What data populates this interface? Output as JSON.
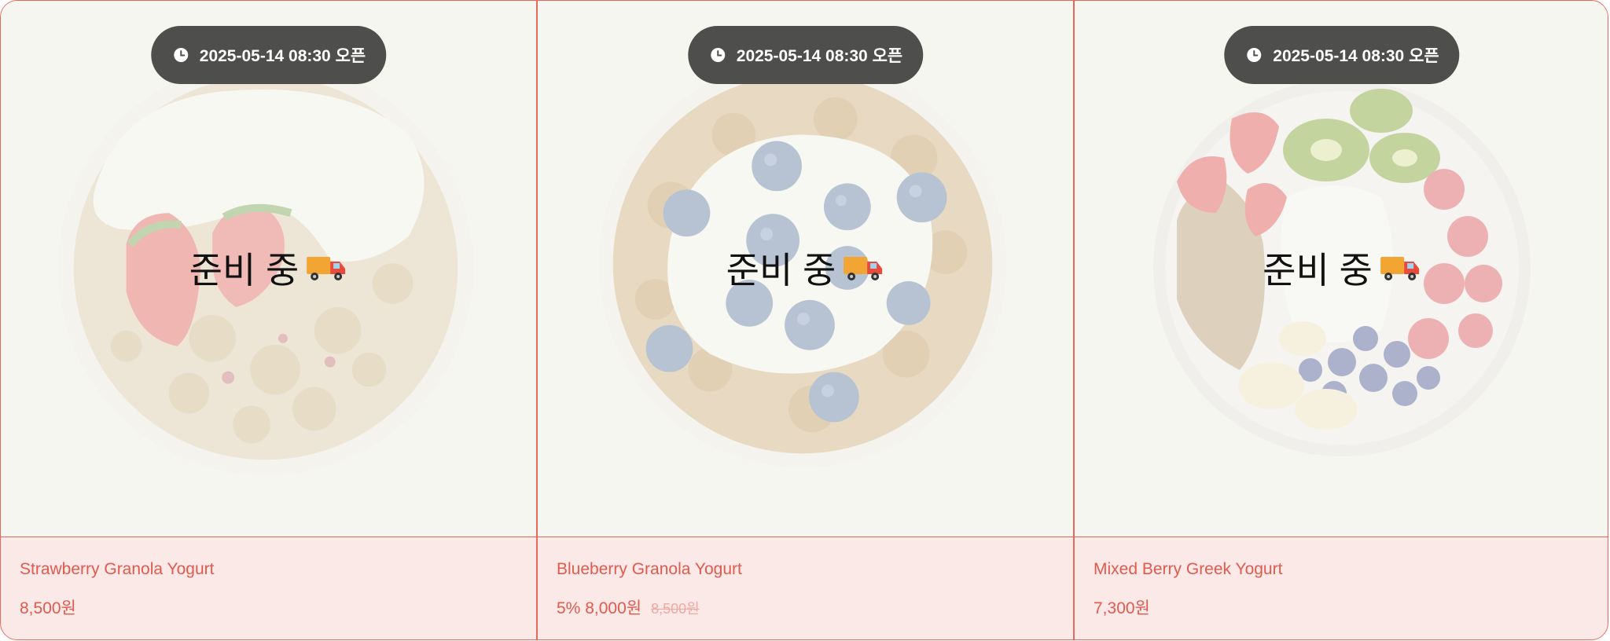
{
  "colors": {
    "accent": "#e8685c",
    "info_bg": "#fbe9e8",
    "pill_bg": "#4e4e4c",
    "image_bg": "#f6f5f1"
  },
  "products": [
    {
      "open_time": "2025-05-14 08:30 오픈",
      "status": "준비 중",
      "status_icon": "delivery-truck-icon",
      "name": "Strawberry Granola Yogurt",
      "discount": "",
      "price": "8,500원",
      "original_price": ""
    },
    {
      "open_time": "2025-05-14 08:30 오픈",
      "status": "준비 중",
      "status_icon": "delivery-truck-icon",
      "name": "Blueberry Granola Yogurt",
      "discount": "5%",
      "price": "8,000원",
      "original_price": "8,500원"
    },
    {
      "open_time": "2025-05-14 08:30 오픈",
      "status": "준비 중",
      "status_icon": "delivery-truck-icon",
      "name": "Mixed Berry Greek Yogurt",
      "discount": "",
      "price": "7,300원",
      "original_price": ""
    }
  ]
}
